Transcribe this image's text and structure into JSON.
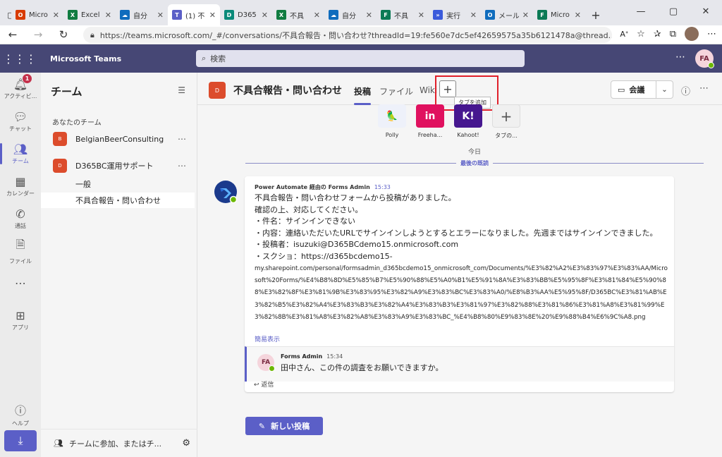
{
  "browser": {
    "tabs": [
      {
        "label": "Micro",
        "color": "#d83b01",
        "glyph": "O"
      },
      {
        "label": "Excel",
        "color": "#107c41",
        "glyph": "X"
      },
      {
        "label": "自分",
        "color": "#0f6cbd",
        "glyph": "☁"
      },
      {
        "label": "(1) 不",
        "color": "#5b5fc7",
        "glyph": "T"
      },
      {
        "label": "D365",
        "color": "#0b8a7a",
        "glyph": "D"
      },
      {
        "label": "不具",
        "color": "#107c41",
        "glyph": "X"
      },
      {
        "label": "自分",
        "color": "#0f6cbd",
        "glyph": "☁"
      },
      {
        "label": "不具",
        "color": "#0b7a55",
        "glyph": "F"
      },
      {
        "label": "実行",
        "color": "#3b5bdb",
        "glyph": "»"
      },
      {
        "label": "メール",
        "color": "#0f6cbd",
        "glyph": "O"
      },
      {
        "label": "Micro",
        "color": "#0b7a55",
        "glyph": "F"
      }
    ],
    "url": "https://teams.microsoft.com/_#/conversations/不具合報告・問い合わせ?threadId=19:fe560e7dc5ef42659575a35b6121478a@thread...",
    "read_aloud": "Aᐩ"
  },
  "teams": {
    "app_title": "Microsoft Teams",
    "search_placeholder": "検索",
    "user_initials": "FA"
  },
  "rail": {
    "items": [
      {
        "label": "アクティビ...",
        "icon": "bell-icon",
        "badge": "1"
      },
      {
        "label": "チャット",
        "icon": "chat-icon"
      },
      {
        "label": "チーム",
        "icon": "teams-icon"
      },
      {
        "label": "カレンダー",
        "icon": "calendar-icon"
      },
      {
        "label": "通話",
        "icon": "phone-icon"
      },
      {
        "label": "ファイル",
        "icon": "file-icon"
      },
      {
        "label": "...",
        "icon": "more-icon"
      },
      {
        "label": "アプリ",
        "icon": "apps-icon"
      }
    ],
    "help_label": "ヘルプ"
  },
  "sidebar": {
    "title": "チーム",
    "section": "あなたのチーム",
    "teams": [
      {
        "name": "BelgianBeerConsulting",
        "initial": "B"
      },
      {
        "name": "D365BC運用サポート",
        "initial": "D"
      }
    ],
    "channels": [
      "一般",
      "不具合報告・問い合わせ"
    ],
    "join_label": "チームに参加、またはチ..."
  },
  "channel": {
    "initial": "D",
    "title": "不具合報告・問い合わせ",
    "tabs": [
      "投稿",
      "ファイル",
      "Wiki"
    ],
    "add_tab_tooltip": "タブを追加",
    "meet_label": "会議",
    "apps": [
      {
        "label": "Polly",
        "color": "#eef1fa",
        "text": "🦜",
        "fg": "#f58220"
      },
      {
        "label": "Freeha...",
        "color": "#e0115f",
        "text": "in",
        "fg": "#ffffff"
      },
      {
        "label": "Kahoot!",
        "color": "#46178f",
        "text": "K!",
        "fg": "#ffffff"
      },
      {
        "label": "タブの...",
        "color": "#f0f0f0",
        "text": "+",
        "fg": "#555555"
      }
    ],
    "today": "今日",
    "last_read": "最後の既読"
  },
  "message": {
    "sender": "Power Automate 経由の Forms Admin",
    "time": "15:33",
    "lines": [
      "不具合報告・問い合わせフォームから投稿がありました。",
      "確認の上、対応してください。",
      "・件名：サインインできない",
      "・内容：連絡いただいたURLでサインインしようとするとエラーになりました。先週まではサインインできました。",
      "・投稿者：isuzuki@D365BCdemo15.onmicrosoft.com",
      "・スクショ：https://d365bcdemo15-"
    ],
    "url_text": "my.sharepoint.com/personal/formsadmin_d365bcdemo15_onmicrosoft_com/Documents/%E3%82%A2%E3%83%97%E3%83%AA/Microsoft%20Forms/%E4%B8%8D%E5%85%B7%E5%90%88%E5%A0%B1%E5%91%8A%E3%83%BB%E5%95%8F%E3%81%84%E5%90%88%E3%82%8F%E3%81%9B%E3%83%95%E3%82%A9%E3%83%BC%E3%83%A0/%E8%B3%AA%E5%95%8F/D365BC%E3%81%AB%E3%82%B5%E3%82%A4%E3%83%B3%E3%82%A4%E3%83%B3%E3%81%97%E3%82%88%E3%81%86%E3%81%A8%E3%81%99%E3%82%8B%E3%81%A8%E3%82%A8%E3%83%A9%E3%83%BC_%E4%B8%80%E9%83%8E%20%E9%88%B4%E6%9C%A8.png",
    "short_view": "簡易表示",
    "reply": {
      "initials": "FA",
      "sender": "Forms Admin",
      "time": "15:34",
      "text": "田中さん、この件の調査をお願いできますか。"
    },
    "reply_label": "返信"
  },
  "new_post_label": "新しい投稿"
}
